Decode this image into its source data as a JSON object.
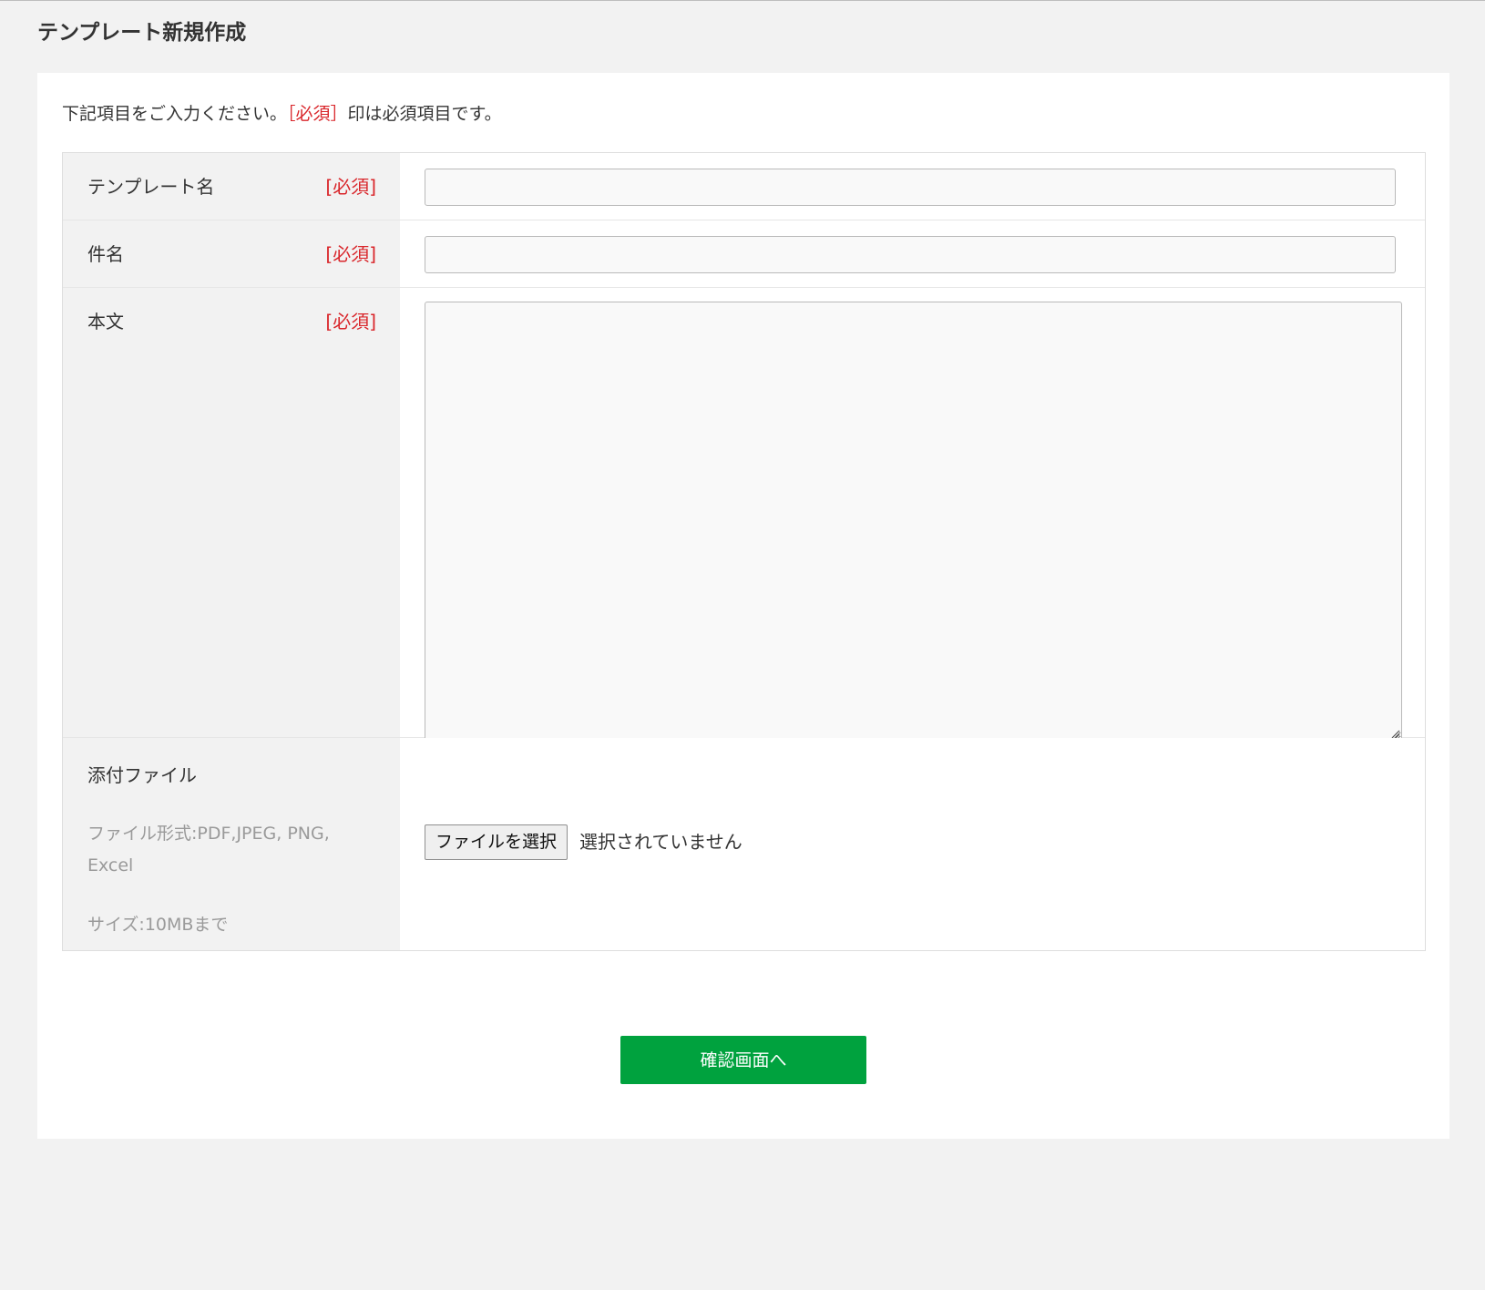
{
  "page": {
    "title": "テンプレート新規作成"
  },
  "intro": {
    "before": "下記項目をご入力ください。",
    "required_mark": "［必須］",
    "after": "印は必須項目です。"
  },
  "fields": {
    "template_name": {
      "label": "テンプレート名",
      "required": "[必須]",
      "value": "",
      "placeholder": ""
    },
    "subject": {
      "label": "件名",
      "required": "[必須]",
      "value": "",
      "placeholder": ""
    },
    "body": {
      "label": "本文",
      "required": "[必須]",
      "value": ""
    },
    "attachment": {
      "label": "添付ファイル",
      "format_hint": "ファイル形式:PDF,JPEG, PNG, Excel",
      "size_hint": "サイズ:10MBまで",
      "button_label": "ファイルを選択",
      "status": "選択されていません"
    }
  },
  "actions": {
    "submit_label": "確認画面へ"
  },
  "colors": {
    "background": "#f2f2f2",
    "panel": "#ffffff",
    "required": "#d9262b",
    "accent": "#00a23e",
    "label_cell": "#f2f2f2"
  }
}
